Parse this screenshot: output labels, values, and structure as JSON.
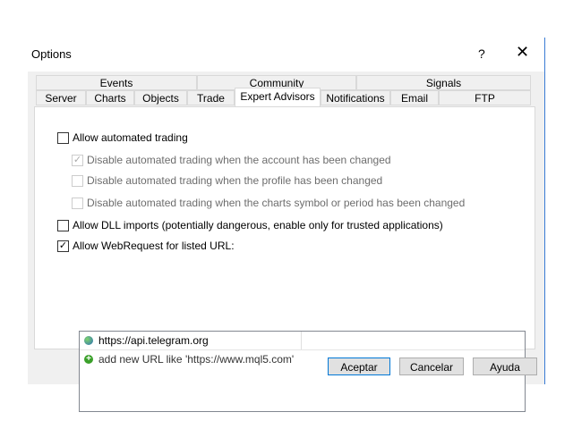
{
  "window": {
    "title": "Options",
    "help": "?",
    "close": "✕"
  },
  "tabs_top": [
    "Events",
    "Community",
    "Signals"
  ],
  "tabs_bottom": [
    "Server",
    "Charts",
    "Objects",
    "Trade",
    "Expert Advisors",
    "Notifications",
    "Email",
    "FTP"
  ],
  "selected_tab": "Expert Advisors",
  "options": [
    {
      "label": "Allow automated trading",
      "checked": false,
      "enabled": true
    },
    {
      "label": "Disable automated trading when the account has been changed",
      "checked": true,
      "enabled": false
    },
    {
      "label": "Disable automated trading when the profile has been changed",
      "checked": false,
      "enabled": false
    },
    {
      "label": "Disable automated trading when the charts symbol or period has been changed",
      "checked": false,
      "enabled": false
    },
    {
      "label": "Allow DLL imports (potentially dangerous, enable only for trusted applications)",
      "checked": false,
      "enabled": true
    },
    {
      "label": "Allow WebRequest for listed URL:",
      "checked": true,
      "enabled": true
    }
  ],
  "url_list": {
    "items": [
      "https://api.telegram.org"
    ],
    "add_new": "add new URL like 'https://www.mql5.com'"
  },
  "buttons": {
    "ok": "Aceptar",
    "cancel": "Cancelar",
    "help": "Ayuda"
  },
  "colors": {
    "arrow": "#e81123",
    "accent": "#0078d7"
  }
}
